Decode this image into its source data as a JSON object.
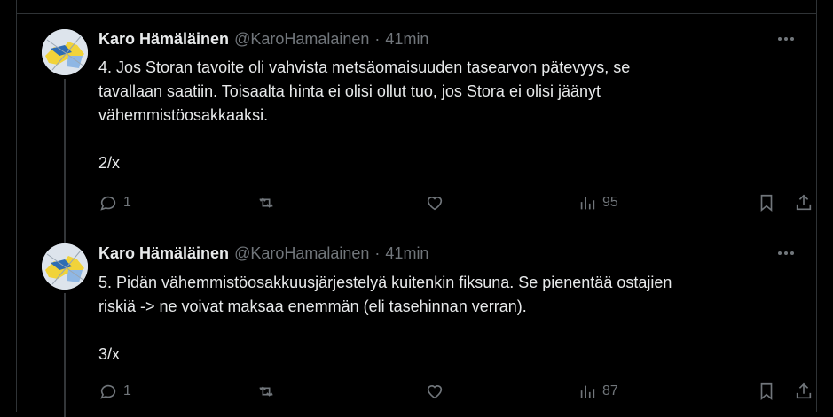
{
  "tweets": [
    {
      "author": "Karo Hämäläinen",
      "handle": "@KaroHamalainen",
      "separator": "·",
      "time": "41min",
      "line1": "4. Jos Storan tavoite oli vahvista metsäomaisuuden tasearvon pätevyys, se",
      "line2": "tavallaan saatiin. Toisaalta hinta ei olisi ollut tuo, jos Stora ei olisi jäänyt",
      "line3": "vähemmistöosakkaaksi.",
      "counter": "2/x",
      "replies": "1",
      "views": "95"
    },
    {
      "author": "Karo Hämäläinen",
      "handle": "@KaroHamalainen",
      "separator": "·",
      "time": "41min",
      "line1": "5. Pidän vähemmistöosakkuusjärjestelyä kuitenkin fiksuna. Se pienentää ostajien",
      "line2": "riskiä -> ne voivat maksaa enemmän (eli tasehinnan verran).",
      "counter": "3/x",
      "replies": "1",
      "views": "87"
    }
  ],
  "icons": {
    "more": "more-icon",
    "reply": "reply-icon",
    "repost": "repost-icon",
    "like": "heart-icon",
    "views": "views-icon",
    "bookmark": "bookmark-icon",
    "share": "share-icon"
  },
  "colors": {
    "background": "#000000",
    "text": "#e7e9ea",
    "muted": "#71767b",
    "border": "#2f3336"
  }
}
